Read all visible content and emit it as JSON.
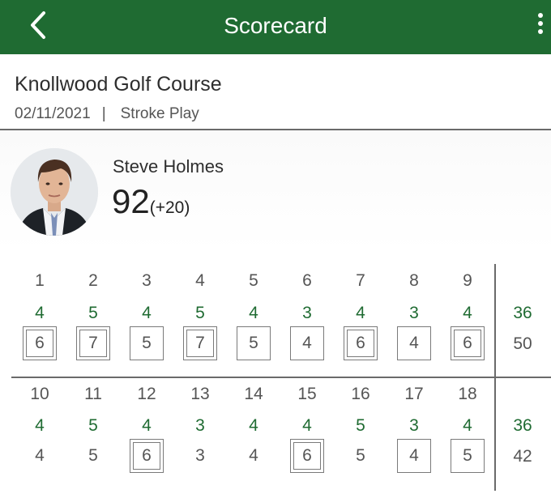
{
  "header": {
    "title": "Scorecard",
    "back_icon": "chevron-left-icon",
    "menu_icon": "more-vertical-icon",
    "bar_color": "#1f6b32"
  },
  "round": {
    "course_name": "Knollwood Golf Course",
    "date": "02/11/2021",
    "separator": "|",
    "format": "Stroke Play"
  },
  "player": {
    "name": "Steve Holmes",
    "total": "92",
    "relative": "(+20)"
  },
  "front_nine": {
    "holes": [
      "1",
      "2",
      "3",
      "4",
      "5",
      "6",
      "7",
      "8",
      "9"
    ],
    "pars": [
      "4",
      "5",
      "4",
      "5",
      "4",
      "3",
      "4",
      "3",
      "4"
    ],
    "scores": [
      "6",
      "7",
      "5",
      "7",
      "5",
      "4",
      "6",
      "4",
      "6"
    ],
    "markers": [
      "double-bogey",
      "double-bogey",
      "bogey",
      "double-bogey",
      "bogey",
      "bogey",
      "double-bogey",
      "bogey",
      "double-bogey"
    ],
    "total_par": "36",
    "total_score": "50"
  },
  "back_nine": {
    "holes": [
      "10",
      "11",
      "12",
      "13",
      "14",
      "15",
      "16",
      "17",
      "18"
    ],
    "pars": [
      "4",
      "5",
      "4",
      "3",
      "4",
      "4",
      "5",
      "3",
      "4"
    ],
    "scores": [
      "4",
      "5",
      "6",
      "3",
      "4",
      "6",
      "5",
      "4",
      "5"
    ],
    "markers": [
      "none",
      "none",
      "double-bogey",
      "none",
      "none",
      "double-bogey",
      "none",
      "bogey",
      "bogey"
    ],
    "total_par": "36",
    "total_score": "42"
  },
  "colors": {
    "accent": "#1f6b32",
    "text": "#333333",
    "divider": "#6a6a6a"
  }
}
